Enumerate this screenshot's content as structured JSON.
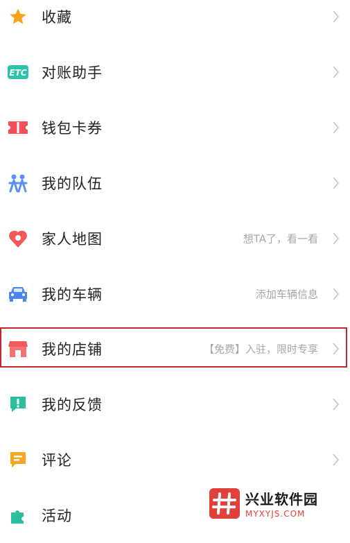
{
  "menu": {
    "items": [
      {
        "label": "收藏",
        "hint": "",
        "icon": "star-icon"
      },
      {
        "label": "对账助手",
        "hint": "",
        "icon": "etc-icon"
      },
      {
        "label": "钱包卡券",
        "hint": "",
        "icon": "ticket-icon"
      },
      {
        "label": "我的队伍",
        "hint": "",
        "icon": "team-icon"
      },
      {
        "label": "家人地图",
        "hint": "想TA了，看一看",
        "icon": "heart-location-icon"
      },
      {
        "label": "我的车辆",
        "hint": "添加车辆信息",
        "icon": "car-icon"
      },
      {
        "label": "我的店铺",
        "hint": "【免费】入驻，限时专享",
        "icon": "store-icon"
      },
      {
        "label": "我的反馈",
        "hint": "",
        "icon": "feedback-icon"
      },
      {
        "label": "评论",
        "hint": "",
        "icon": "comment-icon"
      },
      {
        "label": "活动",
        "hint": "",
        "icon": "puzzle-icon"
      }
    ]
  },
  "etc_icon_text": "ETC",
  "watermark": {
    "title": "兴业软件园",
    "subtitle": "MYXYJS.COM"
  },
  "colors": {
    "star": "#f7a21b",
    "etc": "#2bc4ab",
    "ticket": "#f0505a",
    "team": "#5b8ff2",
    "heart": "#f25a5a",
    "car": "#4a86f0",
    "store": "#f05a5a",
    "feedback": "#2bbfa0",
    "comment": "#f5a623",
    "puzzle": "#2bbfa0",
    "highlight_border": "#c8242c"
  }
}
